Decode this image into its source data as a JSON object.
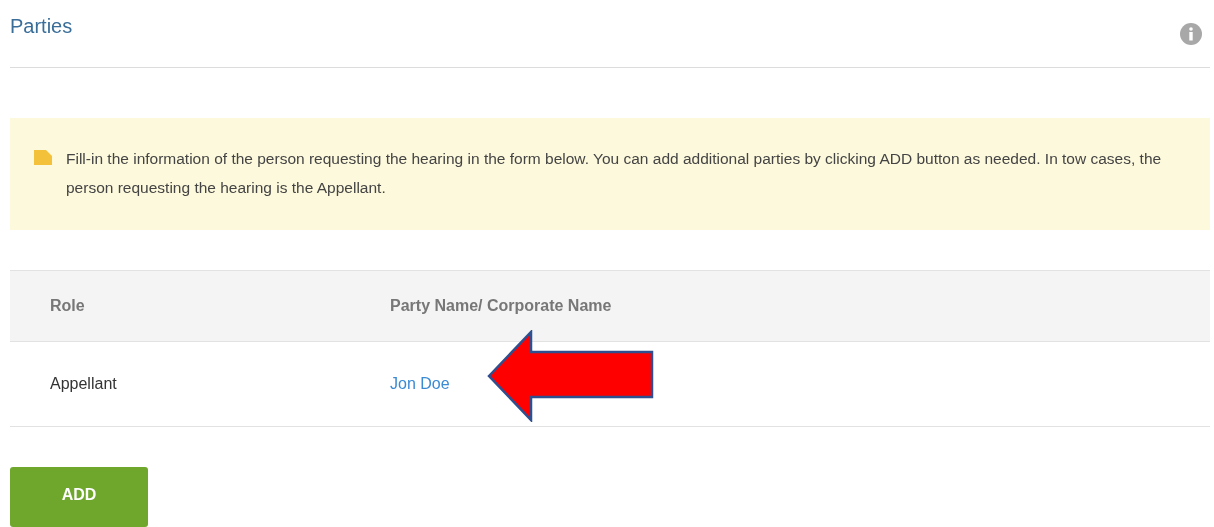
{
  "header": {
    "title": "Parties"
  },
  "notice": {
    "text": "Fill-in the information of the person requesting the hearing in the form below. You can add additional parties by clicking ADD button as needed. In tow cases, the person requesting the hearing is the Appellant."
  },
  "table": {
    "columns": [
      "Role",
      "Party Name/ Corporate Name"
    ],
    "rows": [
      {
        "role": "Appellant",
        "party_name": "Jon Doe"
      }
    ]
  },
  "buttons": [
    "ADD"
  ]
}
